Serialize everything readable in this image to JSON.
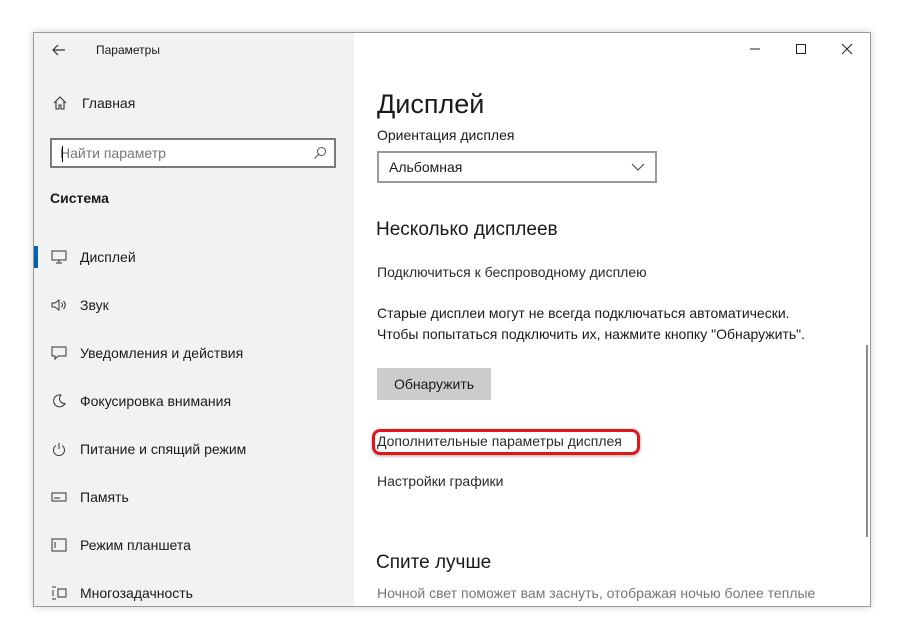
{
  "window": {
    "title": "Параметры",
    "controls": {
      "minimize": "minimize-icon",
      "maximize": "maximize-icon",
      "close": "close-icon"
    }
  },
  "sidebar": {
    "home_label": "Главная",
    "search_placeholder": "Найти параметр",
    "section_title": "Система",
    "items": [
      {
        "label": "Дисплей",
        "icon": "monitor-icon",
        "selected": true
      },
      {
        "label": "Звук",
        "icon": "speaker-icon"
      },
      {
        "label": "Уведомления и действия",
        "icon": "notification-icon"
      },
      {
        "label": "Фокусировка внимания",
        "icon": "moon-icon"
      },
      {
        "label": "Питание и спящий режим",
        "icon": "power-icon"
      },
      {
        "label": "Память",
        "icon": "storage-icon"
      },
      {
        "label": "Режим планшета",
        "icon": "tablet-icon"
      },
      {
        "label": "Многозадачность",
        "icon": "multitask-icon"
      }
    ]
  },
  "main": {
    "page_title": "Дисплей",
    "orientation_label": "Ориентация дисплея",
    "orientation_value": "Альбомная",
    "multi_heading": "Несколько дисплеев",
    "wireless_link": "Подключиться к беспроводному дисплею",
    "old_displays_text": "Старые дисплеи могут не всегда подключаться автоматически. Чтобы попытаться подключить их, нажмите кнопку \"Обнаружить\".",
    "detect_button": "Обнаружить",
    "advanced_link": "Дополнительные параметры дисплея",
    "graphics_link": "Настройки графики",
    "sleep_heading": "Спите лучше",
    "night_light_text": "Ночной свет поможет вам заснуть, отображая ночью более теплые"
  },
  "colors": {
    "accent": "#0063b1",
    "highlight": "#e0161d",
    "sidebar_bg": "#f2f2f2"
  }
}
